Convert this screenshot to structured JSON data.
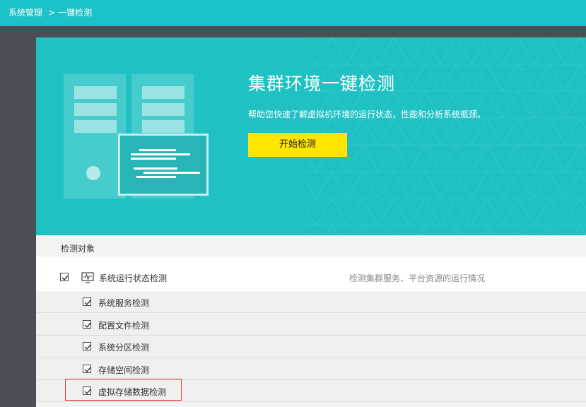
{
  "breadcrumb": {
    "root": "系统管理",
    "separator": ">",
    "current": "一键检测"
  },
  "hero": {
    "title": "集群环境一键检测",
    "description": "帮助您快速了解虚拟机环境的运行状态，性能和分析系统瓶颈。",
    "start_button": "开始检测"
  },
  "detection": {
    "section_title": "检测对象",
    "main_item": {
      "label": "系统运行状态检测",
      "description": "检测集群服务、平台资源的运行情况",
      "checked": true,
      "icon": "monitor-pulse-icon"
    },
    "sub_items": [
      {
        "label": "系统服务检测",
        "checked": true
      },
      {
        "label": "配置文件检测",
        "checked": true
      },
      {
        "label": "系统分区检测",
        "checked": true
      },
      {
        "label": "存储空间检测",
        "checked": true
      },
      {
        "label": "虚拟存储数据检测",
        "checked": true
      }
    ]
  },
  "colors": {
    "topbar": "#1bc2c7",
    "hero": "#1fc1c3",
    "button": "#ffe500",
    "highlight_border": "#e53935",
    "sidebar": "#4a4f55"
  }
}
